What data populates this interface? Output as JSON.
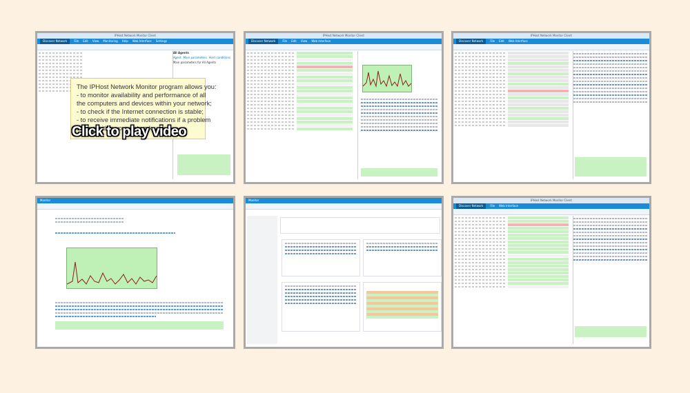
{
  "tooltip": {
    "line1": "The IPHost Network Monitor program allows you:",
    "line2": "- to monitor availability and performance of all",
    "line3": "  the computers and devices within your network;",
    "line4": "- to check if the Internet connection is stable;",
    "line5": "- to receive immediate notifications if a problem",
    "line6": "  occurs within your network."
  },
  "play_label": "Click to play video",
  "screens": [
    {
      "name": "IPHost Network Monitor Client",
      "menu": [
        "Discover Network",
        "File",
        "Edit",
        "View",
        "Monitoring",
        "Help",
        "Web Interface",
        "Settings"
      ]
    },
    {
      "name": "IPHost Network Monitor Client",
      "menu": [
        "Discover Network",
        "File",
        "Edit",
        "View",
        "Monitoring",
        "Help",
        "Web Interface",
        "Settings"
      ]
    },
    {
      "name": "IPHost Network Monitor Client",
      "menu": [
        "Discover Network",
        "File",
        "Edit",
        "View",
        "Monitoring",
        "Help",
        "Web Interface",
        "Settings"
      ]
    },
    {
      "name": "Monitor",
      "menu": []
    },
    {
      "name": "Monitor",
      "menu": []
    },
    {
      "name": "IPHost Network Monitor Client",
      "menu": [
        "Discover Network",
        "File",
        "Edit",
        "View",
        "Monitoring",
        "Help",
        "Web Interface",
        "Settings"
      ]
    }
  ],
  "thumb1": {
    "group_title": "All Agents",
    "tab_labels": [
      "Agent",
      "Main parameters",
      "Alert conditions"
    ],
    "panel_title": "Main parameters for All Agents"
  },
  "colors": {
    "accent": "#1a8bd6",
    "ok": "#c9f2c3",
    "down": "#f4b3b3",
    "tooltip": "#fffbd1",
    "background": "#fdf1e2"
  }
}
